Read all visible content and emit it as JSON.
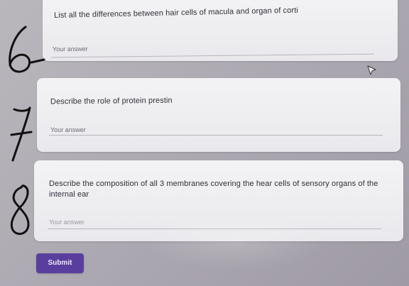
{
  "questions": [
    {
      "text": "List all the differences between hair cells of macula and organ of corti",
      "answer_placeholder": "Your answer"
    },
    {
      "text": "Describe the role of protein prestin",
      "answer_placeholder": "Your answer"
    },
    {
      "text": "Describe the composition of all 3 membranes covering the hear cells of sensory organs of the internal ear",
      "answer_placeholder": "Your answer"
    }
  ],
  "submit_label": "Submit",
  "handwritten_numbers": [
    "6",
    "7",
    "8"
  ],
  "colors": {
    "submit": "#5a3e9e",
    "card": "#f0eff2",
    "background": "#aeaab3",
    "ink": "#111111"
  }
}
